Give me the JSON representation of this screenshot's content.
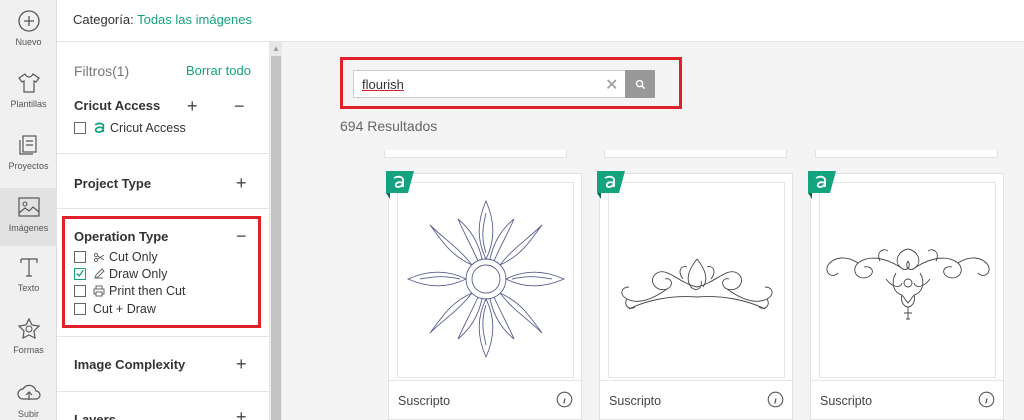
{
  "rail": {
    "items": [
      {
        "label": "Nuevo",
        "icon": "plus-circle-icon"
      },
      {
        "label": "Plantillas",
        "icon": "tshirt-icon"
      },
      {
        "label": "Proyectos",
        "icon": "projects-icon"
      },
      {
        "label": "Imágenes",
        "icon": "image-icon"
      },
      {
        "label": "Texto",
        "icon": "text-icon"
      },
      {
        "label": "Formas",
        "icon": "shapes-icon"
      },
      {
        "label": "Subir",
        "icon": "upload-cloud-icon"
      }
    ],
    "active": "Imágenes"
  },
  "header": {
    "category_label": "Categoría:",
    "category_value": "Todas las imágenes"
  },
  "filters": {
    "title": "Filtros(1)",
    "clear_all": "Borrar todo",
    "sections": {
      "cricut_access": {
        "title": "Cricut Access",
        "option": "Cricut Access"
      },
      "project_type": {
        "title": "Project Type"
      },
      "operation_type": {
        "title": "Operation Type",
        "options": [
          {
            "label": "Cut Only",
            "checked": false
          },
          {
            "label": "Draw Only",
            "checked": true
          },
          {
            "label": "Print then Cut",
            "checked": false
          },
          {
            "label": "Cut + Draw",
            "checked": false
          }
        ]
      },
      "image_complexity": {
        "title": "Image Complexity"
      },
      "layers": {
        "title": "Layers"
      }
    }
  },
  "search": {
    "value": "flourish"
  },
  "results": {
    "count_text": "694 Resultados"
  },
  "cards": [
    {
      "status": "Suscripto"
    },
    {
      "status": "Suscripto"
    },
    {
      "status": "Suscripto"
    }
  ],
  "colors": {
    "accent": "#14a37f",
    "highlight": "#e0202a"
  }
}
